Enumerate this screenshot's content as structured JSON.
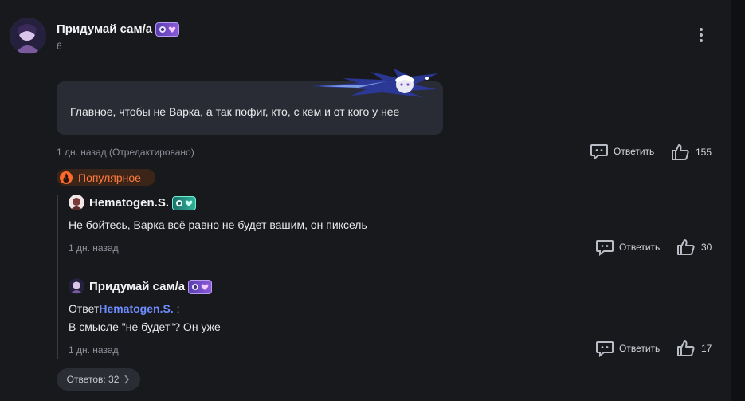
{
  "main_comment": {
    "author": "Придумай сам/а",
    "count": "6",
    "text": "Главное, чтобы не Варка, а так пофиг, кто, с кем и от кого у нее",
    "time": "1 дн. назад (Отредактировано)",
    "reply_label": "Ответить",
    "likes": "155"
  },
  "popular_label": "Популярное",
  "replies": [
    {
      "author": "Hematogen.S.",
      "text": "Не бойтесь, Варка всё равно не будет вашим, он пиксель",
      "time": "1 дн. назад",
      "reply_label": "Ответить",
      "likes": "30"
    },
    {
      "author": "Придумай сам/а",
      "reply_prefix": "Ответ",
      "reply_to": "Hematogen.S.",
      "reply_suffix": " :",
      "text": "В смысле \"не будет\"? Он уже",
      "time": "1 дн. назад",
      "reply_label": "Ответить",
      "likes": "17"
    }
  ],
  "replies_button": "Ответов: 32",
  "colors": {
    "background": "#18191d",
    "bubble": "#2a2c35",
    "popular": "#ff7a3d",
    "mention": "#6f8cff"
  }
}
